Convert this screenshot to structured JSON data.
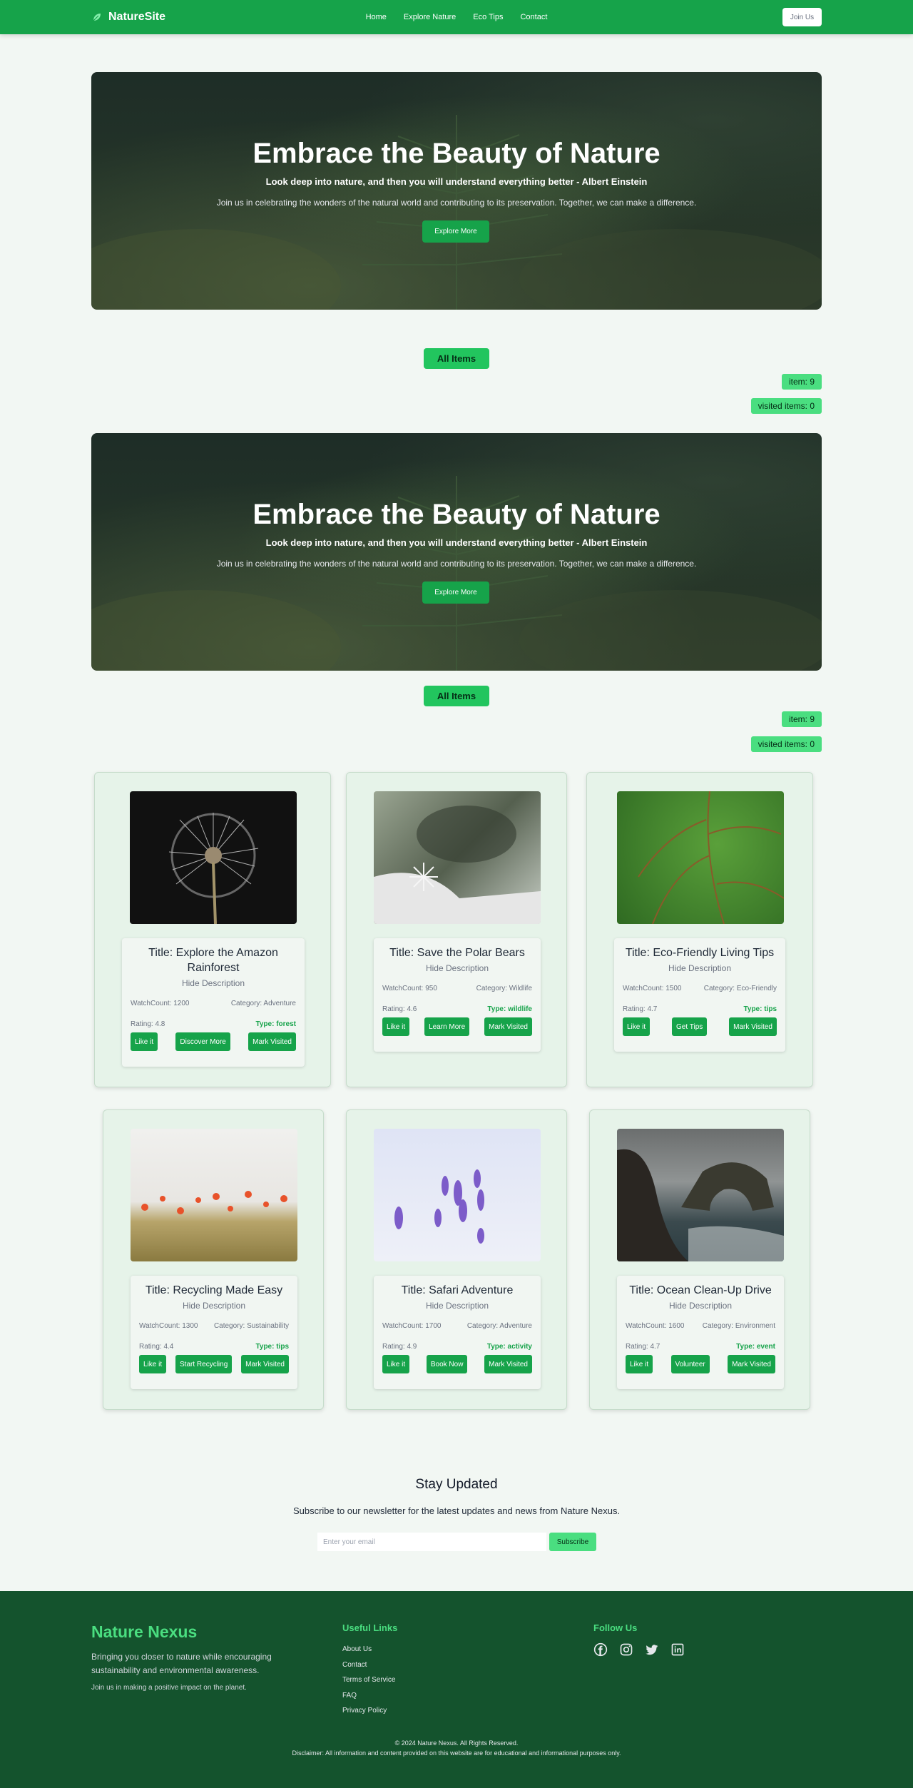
{
  "nav": {
    "brand": "NatureSite",
    "links": [
      "Home",
      "Explore Nature",
      "Eco Tips",
      "Contact"
    ],
    "join": "Join Us"
  },
  "hero": {
    "title": "Embrace the Beauty of Nature",
    "quote": "Look deep into nature, and then you will understand everything better - Albert Einstein",
    "subtitle": "Join us in celebrating the wonders of the natural world and contributing to its preservation. Together, we can make a difference.",
    "button": "Explore More"
  },
  "filters": {
    "all_items": "All Items",
    "item_count": "item: 9",
    "visited": "visited items: 0"
  },
  "cards": [
    {
      "title": "Title: Explore the Amazon Rainforest",
      "toggle": "Hide Description",
      "watch": "WatchCount: 1200",
      "category": "Category: Adventure",
      "rating": "Rating: 4.8",
      "type": "Type: forest",
      "like": "Like it",
      "action": "Discover More",
      "visit": "Mark Visited",
      "image": "dandelion"
    },
    {
      "title": "Title: Save the Polar Bears",
      "toggle": "Hide Description",
      "watch": "WatchCount: 950",
      "category": "Category: Wildlife",
      "rating": "Rating: 4.6",
      "type": "Type: wildlife",
      "like": "Like it",
      "action": "Learn More",
      "visit": "Mark Visited",
      "image": "snowflake"
    },
    {
      "title": "Title: Eco-Friendly Living Tips",
      "toggle": "Hide Description",
      "watch": "WatchCount: 1500",
      "category": "Category: Eco-Friendly",
      "rating": "Rating: 4.7",
      "type": "Type: tips",
      "like": "Like it",
      "action": "Get Tips",
      "visit": "Mark Visited",
      "image": "leaf"
    },
    {
      "title": "Title: Recycling Made Easy",
      "toggle": "Hide Description",
      "watch": "WatchCount: 1300",
      "category": "Category: Sustainability",
      "rating": "Rating: 4.4",
      "type": "Type: tips",
      "like": "Like it",
      "action": "Start Recycling",
      "visit": "Mark Visited",
      "image": "poppies"
    },
    {
      "title": "Title: Safari Adventure",
      "toggle": "Hide Description",
      "watch": "WatchCount: 1700",
      "category": "Category: Adventure",
      "rating": "Rating: 4.9",
      "type": "Type: activity",
      "like": "Like it",
      "action": "Book Now",
      "visit": "Mark Visited",
      "image": "crocus"
    },
    {
      "title": "Title: Ocean Clean-Up Drive",
      "toggle": "Hide Description",
      "watch": "WatchCount: 1600",
      "category": "Category: Environment",
      "rating": "Rating: 4.7",
      "type": "Type: event",
      "like": "Like it",
      "action": "Volunteer",
      "visit": "Mark Visited",
      "image": "sea-arch"
    }
  ],
  "newsletter": {
    "title": "Stay Updated",
    "text": "Subscribe to our newsletter for the latest updates and news from Nature Nexus.",
    "placeholder": "Enter your email",
    "button": "Subscribe"
  },
  "footer": {
    "name": "Nature Nexus",
    "description": "Bringing you closer to nature while encouraging sustainability and environmental awareness.",
    "join": "Join us in making a positive impact on the planet.",
    "links_title": "Useful Links",
    "links": [
      "About Us",
      "Contact",
      "Terms of Service",
      "FAQ",
      "Privacy Policy"
    ],
    "follow_title": "Follow Us",
    "social": [
      "facebook-icon",
      "instagram-icon",
      "twitter-icon",
      "linkedin-icon"
    ],
    "copyright": "© 2024 Nature Nexus. All Rights Reserved.",
    "disclaimer": "Disclaimer: All information and content provided on this website are for educational and informational purposes only."
  },
  "colors": {
    "primary": "#16a34a",
    "accent": "#4ade80",
    "footer": "#14532d"
  }
}
